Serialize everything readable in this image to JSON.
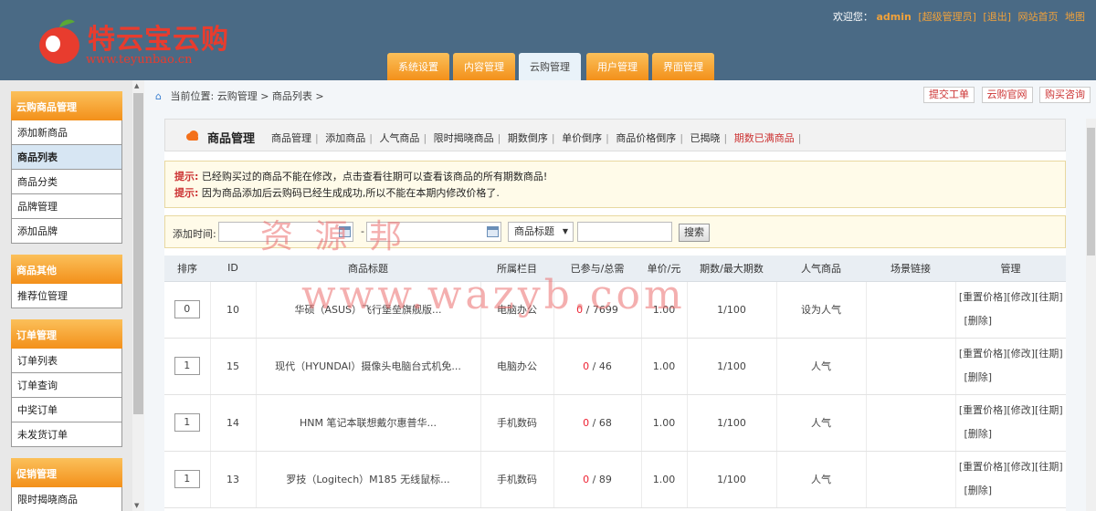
{
  "header": {
    "logo_text": "特云宝云购",
    "logo_url": "www.teyunbao.cn",
    "welcome": "欢迎您：",
    "username": "admin",
    "role": "[超级管理员]",
    "logout": "[退出]",
    "site_home": "网站首页",
    "sitemap": "地图",
    "tabs": [
      {
        "label": "系统设置"
      },
      {
        "label": "内容管理"
      },
      {
        "label": "云购管理"
      },
      {
        "label": "用户管理"
      },
      {
        "label": "界面管理"
      }
    ]
  },
  "sidebar": {
    "groups": [
      {
        "title": "云购商品管理",
        "items": [
          "添加新商品",
          "商品列表",
          "商品分类",
          "品牌管理",
          "添加品牌"
        ]
      },
      {
        "title": "商品其他",
        "items": [
          "推荐位管理"
        ]
      },
      {
        "title": "订单管理",
        "items": [
          "订单列表",
          "订单查询",
          "中奖订单",
          "未发货订单"
        ]
      },
      {
        "title": "促销管理",
        "items": [
          "限时揭晓商品"
        ]
      }
    ]
  },
  "breadcrumb": {
    "text": "当前位置: 云购管理 > 商品列表 >"
  },
  "top_buttons": {
    "submit_ticket": "提交工单",
    "official_site": "云购官网",
    "purchase_inquiry": "购买咨询"
  },
  "panel": {
    "title": "商品管理",
    "nav": [
      "商品管理",
      "添加商品",
      "人气商品",
      "限时揭晓商品",
      "期数倒序",
      "单价倒序",
      "商品价格倒序",
      "已揭晓",
      "期数已满商品"
    ]
  },
  "tips": {
    "label": "提示:",
    "line1": "已经购买过的商品不能在修改，点击查看往期可以查看该商品的所有期数商品!",
    "line2": "因为商品添加后云购码已经生成成功,所以不能在本期内修改价格了."
  },
  "filter": {
    "label": "添加时间:",
    "dash": "-",
    "select_value": "商品标题",
    "search_label": "搜索"
  },
  "table": {
    "headers": [
      "排序",
      "ID",
      "商品标题",
      "所属栏目",
      "已参与/总需",
      "单价/元",
      "期数/最大期数",
      "人气商品",
      "场景链接",
      "管理"
    ],
    "rows": [
      {
        "sort": "0",
        "id": "10",
        "title": "华硕（ASUS）飞行堡垒旗舰版...",
        "category": "电脑办公",
        "joined": "0",
        "total": "7699",
        "price": "1.00",
        "period": "1/100",
        "popular": "设为人气"
      },
      {
        "sort": "1",
        "id": "15",
        "title": "现代（HYUNDAI）摄像头电脑台式机免...",
        "category": "电脑办公",
        "joined": "0",
        "total": "46",
        "price": "1.00",
        "period": "1/100",
        "popular": "人气"
      },
      {
        "sort": "1",
        "id": "14",
        "title": "HNM 笔记本联想戴尔惠普华...",
        "category": "手机数码",
        "joined": "0",
        "total": "68",
        "price": "1.00",
        "period": "1/100",
        "popular": "人气"
      },
      {
        "sort": "1",
        "id": "13",
        "title": "罗技（Logitech）M185 无线鼠标...",
        "category": "手机数码",
        "joined": "0",
        "total": "89",
        "price": "1.00",
        "period": "1/100",
        "popular": "人气"
      }
    ],
    "actions": {
      "reset_price": "[重置价格]",
      "edit": "[修改]",
      "history": "[往期]",
      "delete": "[删除]"
    },
    "slash": " / "
  },
  "watermark": {
    "cn": "资 源 邦",
    "url": "www.wazyb.com"
  },
  "colors": {
    "header_bg": "#4a6a85",
    "accent_orange": "#f3901a",
    "link_orange": "#f2a23a",
    "alert_red": "#e23"
  }
}
